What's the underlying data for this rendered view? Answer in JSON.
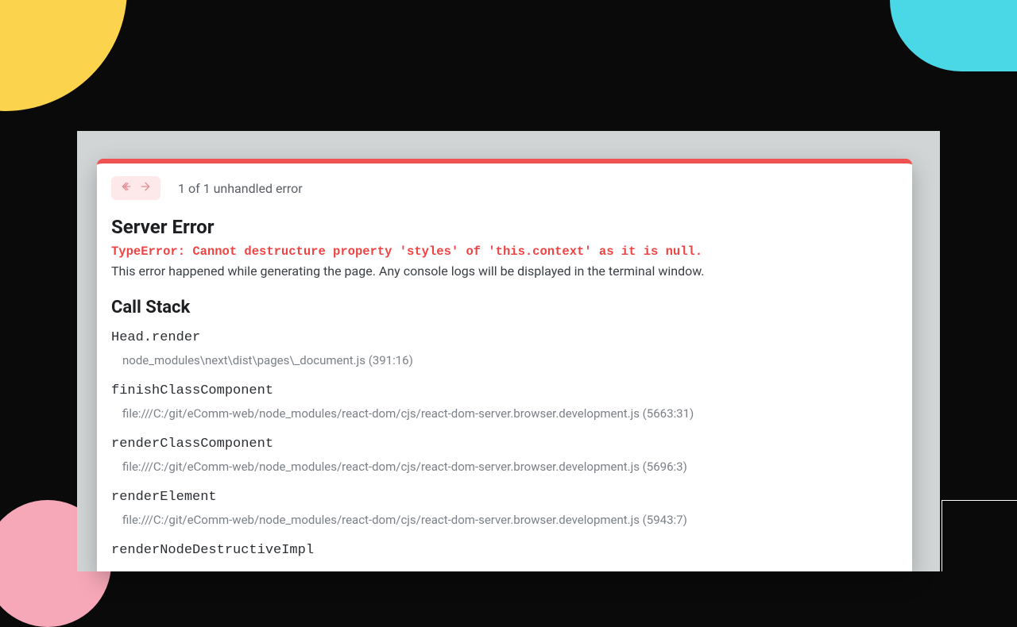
{
  "nav": {
    "counter": "1 of 1 unhandled error"
  },
  "error": {
    "title": "Server Error",
    "message": "TypeError: Cannot destructure property 'styles' of 'this.context' as it is null.",
    "description": "This error happened while generating the page. Any console logs will be displayed in the terminal window."
  },
  "callstack": {
    "heading": "Call Stack",
    "frames": [
      {
        "fn": "Head.render",
        "loc": "node_modules\\next\\dist\\pages\\_document.js (391:16)"
      },
      {
        "fn": "finishClassComponent",
        "loc": "file:///C:/git/eComm-web/node_modules/react-dom/cjs/react-dom-server.browser.development.js (5663:31)"
      },
      {
        "fn": "renderClassComponent",
        "loc": "file:///C:/git/eComm-web/node_modules/react-dom/cjs/react-dom-server.browser.development.js (5696:3)"
      },
      {
        "fn": "renderElement",
        "loc": "file:///C:/git/eComm-web/node_modules/react-dom/cjs/react-dom-server.browser.development.js (5943:7)"
      },
      {
        "fn": "renderNodeDestructiveImpl",
        "loc": ""
      }
    ]
  }
}
